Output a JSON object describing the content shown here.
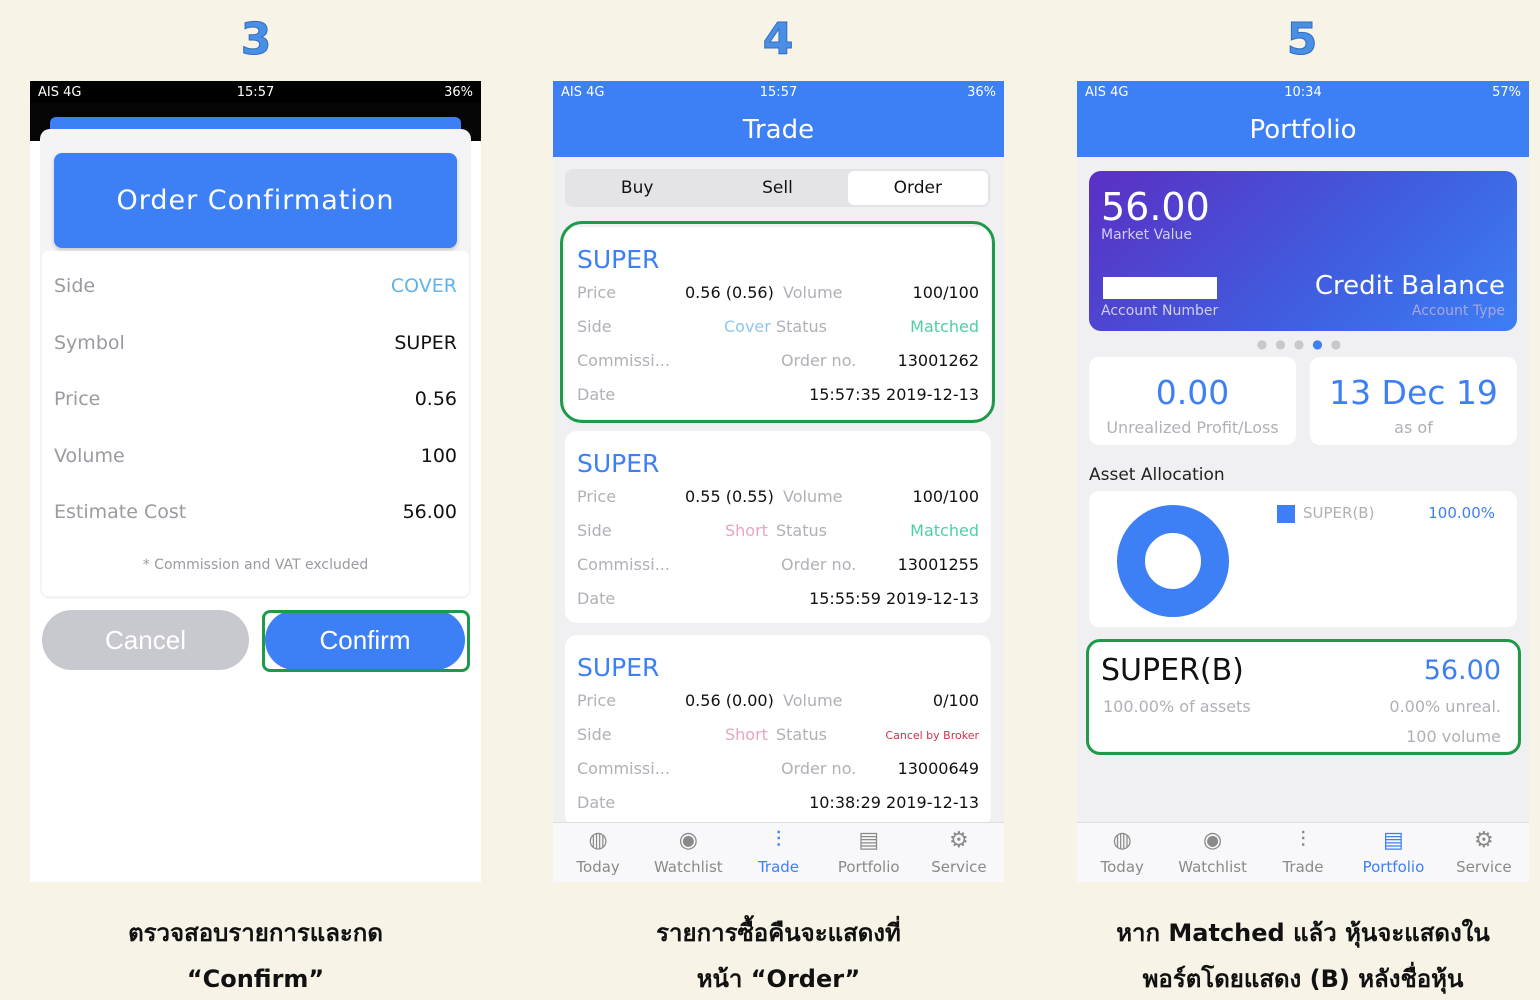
{
  "steps": [
    "3",
    "4",
    "5"
  ],
  "status": {
    "p3": {
      "carrier": "AIS 4G",
      "time": "15:57",
      "battery": "36%"
    },
    "p4": {
      "carrier": "AIS 4G",
      "time": "15:57",
      "battery": "36%"
    },
    "p5": {
      "carrier": "AIS 4G",
      "time": "10:34",
      "battery": "57%"
    }
  },
  "confirm_screen": {
    "title": "Order  Confirmation",
    "rows": [
      {
        "label": "Side",
        "value": "COVER"
      },
      {
        "label": "Symbol",
        "value": "SUPER"
      },
      {
        "label": "Price",
        "value": "0.56"
      },
      {
        "label": "Volume",
        "value": "100"
      },
      {
        "label": "Estimate Cost",
        "value": "56.00"
      }
    ],
    "note": "* Commission and VAT excluded",
    "cancel": "Cancel",
    "confirm": "Confirm"
  },
  "trade_screen": {
    "title": "Trade",
    "tabs": [
      "Buy",
      "Sell",
      "Order"
    ],
    "labels": {
      "price": "Price",
      "volume": "Volume",
      "side": "Side",
      "status": "Status",
      "commission": "Commissi...",
      "order_no": "Order no.",
      "date": "Date"
    },
    "orders": [
      {
        "symbol": "SUPER",
        "price": "0.56 (0.56)",
        "volume": "100/100",
        "side": "Cover",
        "status": "Matched",
        "order_no": "13001262",
        "date": "15:57:35 2019-12-13"
      },
      {
        "symbol": "SUPER",
        "price": "0.55 (0.55)",
        "volume": "100/100",
        "side": "Short",
        "status": "Matched",
        "order_no": "13001255",
        "date": "15:55:59 2019-12-13"
      },
      {
        "symbol": "SUPER",
        "price": "0.56 (0.00)",
        "volume": "0/100",
        "side": "Short",
        "status": "Cancel by Broker",
        "order_no": "13000649",
        "date": "10:38:29 2019-12-13"
      }
    ]
  },
  "portfolio_screen": {
    "title": "Portfolio",
    "market_value": "56.00",
    "market_value_label": "Market Value",
    "account_number_label": "Account Number",
    "account_type_value": "Credit Balance",
    "account_type_label": "Account Type",
    "unrealized": "0.00",
    "unrealized_label": "Unrealized Profit/Loss",
    "as_of": "13 Dec 19",
    "as_of_label": "as of",
    "asset_allocation": "Asset Allocation",
    "legend_name": "SUPER(B)",
    "legend_pct": "100.00%",
    "holding": {
      "symbol": "SUPER(B)",
      "value": "56.00",
      "pct_assets": "100.00% of assets",
      "unreal": "0.00% unreal.",
      "volume": "100 volume"
    }
  },
  "tabbar": [
    "Today",
    "Watchlist",
    "Trade",
    "Portfolio",
    "Service"
  ],
  "captions": {
    "c3": [
      "ตรวจสอบรายการและกด",
      "“Confirm”"
    ],
    "c4": [
      "รายการซื้อคืนจะแสดงที่",
      "หน้า “Order”"
    ],
    "c5": [
      "หาก Matched แล้ว หุ้นจะแสดงใน",
      "พอร์ตโดยแสดง (B) หลังชื่อหุ้น"
    ]
  },
  "colors": {
    "accent": "#3d7ff5",
    "highlight": "#1f9a4a",
    "matched": "#4dd0a3"
  }
}
